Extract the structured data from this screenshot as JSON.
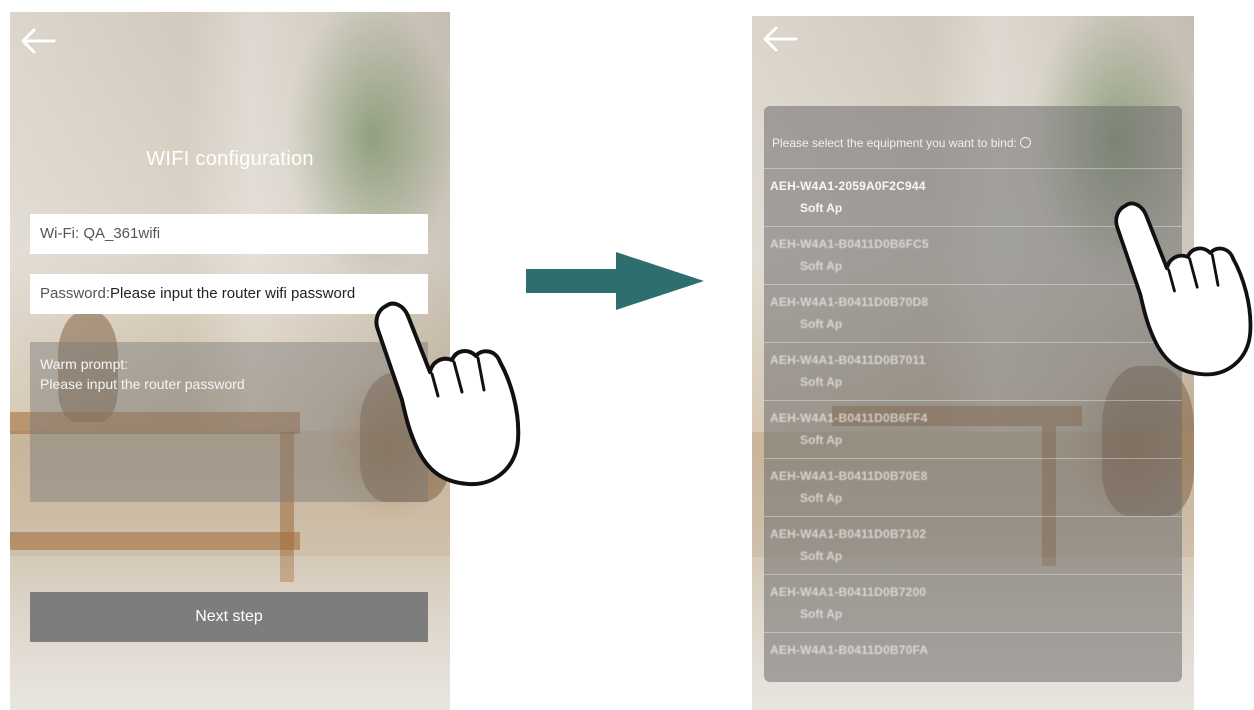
{
  "screen1": {
    "title": "WIFI configuration",
    "wifi_field": "Wi-Fi: QA_361wifi",
    "password_label": "Password:",
    "password_placeholder": "Please input the router wifi password",
    "prompt_title": "Warm prompt:",
    "prompt_text": "Please input the router password",
    "next_button": "Next step"
  },
  "screen2": {
    "header": "Please select the equipment you want to bind:",
    "devices": [
      {
        "name": "AEH-W4A1-2059A0F2C944",
        "type": "Soft Ap"
      },
      {
        "name": "AEH-W4A1-B0411D0B6FC5",
        "type": "Soft Ap"
      },
      {
        "name": "AEH-W4A1-B0411D0B70D8",
        "type": "Soft Ap"
      },
      {
        "name": "AEH-W4A1-B0411D0B7011",
        "type": "Soft Ap"
      },
      {
        "name": "AEH-W4A1-B0411D0B6FF4",
        "type": "Soft Ap"
      },
      {
        "name": "AEH-W4A1-B0411D0B70E8",
        "type": "Soft Ap"
      },
      {
        "name": "AEH-W4A1-B0411D0B7102",
        "type": "Soft Ap"
      },
      {
        "name": "AEH-W4A1-B0411D0B7200",
        "type": "Soft Ap"
      },
      {
        "name": "AEH-W4A1-B0411D0B70FA",
        "type": ""
      }
    ]
  },
  "icons": {
    "back": "arrow-left-icon",
    "flow_arrow": "arrow-right-icon",
    "hand": "pointing-hand-icon"
  },
  "colors": {
    "flow_arrow": "#2f6e6e",
    "button_bg": "#7d7d7d",
    "panel_overlay": "#6e6e6e"
  }
}
